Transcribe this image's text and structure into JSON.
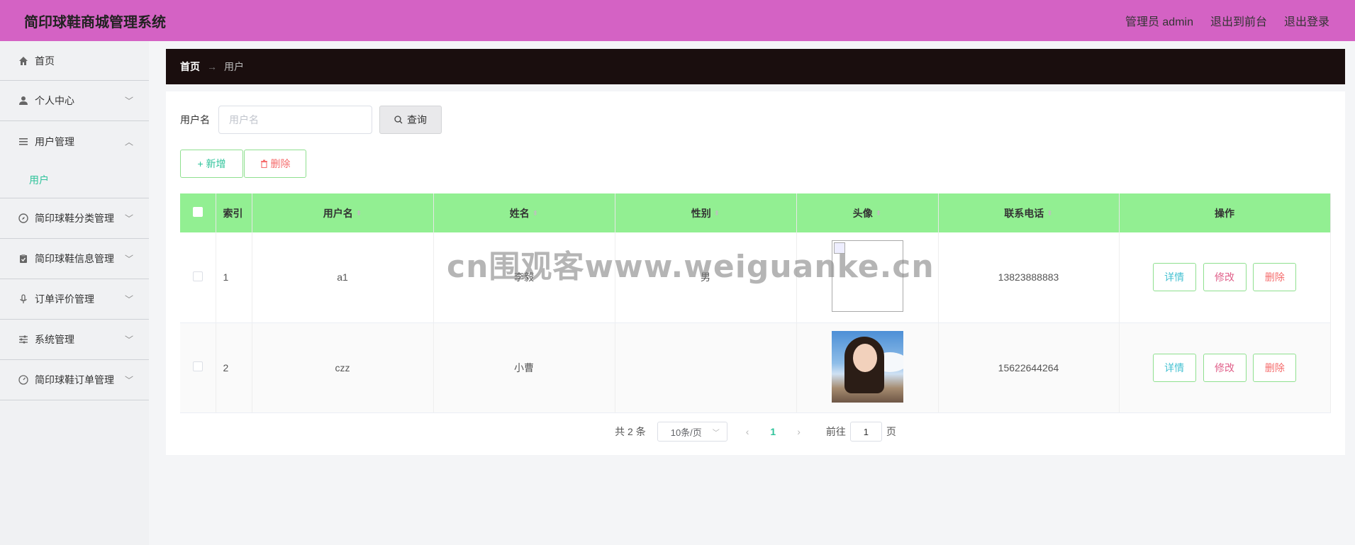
{
  "header": {
    "app_title": "简印球鞋商城管理系统",
    "admin_label": "管理员 admin",
    "front_link": "退出到前台",
    "logout_link": "退出登录"
  },
  "sidebar": {
    "items": [
      {
        "label": "首页",
        "icon": "home-icon"
      },
      {
        "label": "个人中心",
        "icon": "user-icon"
      },
      {
        "label": "用户管理",
        "icon": "list-icon"
      },
      {
        "label": "简印球鞋分类管理",
        "icon": "compass-icon"
      },
      {
        "label": "简印球鞋信息管理",
        "icon": "clipboard-icon"
      },
      {
        "label": "订单评价管理",
        "icon": "microphone-icon"
      },
      {
        "label": "系统管理",
        "icon": "sliders-icon"
      },
      {
        "label": "简印球鞋订单管理",
        "icon": "gauge-icon"
      }
    ],
    "submenu_active": "用户"
  },
  "breadcrumb": {
    "home": "首页",
    "separator": "→",
    "current": "用户"
  },
  "search": {
    "label": "用户名",
    "placeholder": "用户名",
    "button": "查询"
  },
  "actions": {
    "add": "+ 新增",
    "delete": "删除"
  },
  "table": {
    "headers": [
      "索引",
      "用户名",
      "姓名",
      "性别",
      "头像",
      "联系电话",
      "操作"
    ],
    "rows": [
      {
        "index": "1",
        "username": "a1",
        "name": "李毅",
        "gender": "男",
        "avatar": "broken-image",
        "phone": "13823888883"
      },
      {
        "index": "2",
        "username": "czz",
        "name": "小曹",
        "gender": "",
        "avatar": "photo",
        "phone": "15622644264"
      }
    ],
    "op_labels": {
      "detail": "详情",
      "edit": "修改",
      "delete": "删除"
    }
  },
  "pagination": {
    "total": "共 2 条",
    "page_size": "10条/页",
    "current_page": "1",
    "goto_label": "前往",
    "goto_value": "1",
    "page_suffix": "页"
  },
  "watermark": "cn围观客www.weiguanke.cn",
  "colors": {
    "header_bg": "#d462c4",
    "table_header_bg": "#92ef92",
    "accent": "#2ec39a",
    "breadcrumb_bg": "#1a0e0e"
  }
}
